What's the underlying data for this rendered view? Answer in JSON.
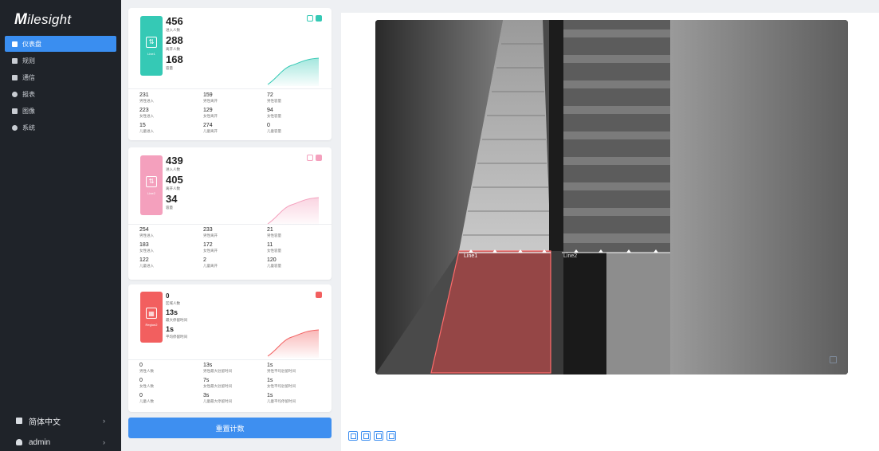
{
  "brand": {
    "logo_initial": "M",
    "logo_rest": "ilesight"
  },
  "sidebar": {
    "items": [
      {
        "label": "仪表盘",
        "icon": "dashboard-icon",
        "active": true
      },
      {
        "label": "规则",
        "icon": "rules-icon",
        "active": false
      },
      {
        "label": "通信",
        "icon": "communication-icon",
        "active": false
      },
      {
        "label": "报表",
        "icon": "report-icon",
        "active": false
      },
      {
        "label": "图像",
        "icon": "image-icon",
        "active": false
      },
      {
        "label": "系统",
        "icon": "gear-icon",
        "active": false
      }
    ],
    "language": {
      "label": "简体中文",
      "icon": "language-icon"
    },
    "user": {
      "label": "admin",
      "icon": "user-icon"
    },
    "chevron": "›"
  },
  "cards": [
    {
      "badge_label": "Line1",
      "accent": "#35c9b5",
      "main": [
        {
          "value": "456",
          "label": "进入人数"
        },
        {
          "value": "288",
          "label": "离开人数"
        },
        {
          "value": "168",
          "label": "容量"
        }
      ],
      "grid": [
        {
          "value": "231",
          "label": "男性进入"
        },
        {
          "value": "159",
          "label": "男性离开"
        },
        {
          "value": "72",
          "label": "男性容量"
        },
        {
          "value": "223",
          "label": "女性进入"
        },
        {
          "value": "129",
          "label": "女性离开"
        },
        {
          "value": "94",
          "label": "女性容量"
        },
        {
          "value": "15",
          "label": "儿童进入"
        },
        {
          "value": "274",
          "label": "儿童离开"
        },
        {
          "value": "0",
          "label": "儿童容量"
        }
      ]
    },
    {
      "badge_label": "Line2",
      "accent": "#f4a0bd",
      "main": [
        {
          "value": "439",
          "label": "进入人数"
        },
        {
          "value": "405",
          "label": "离开人数"
        },
        {
          "value": "34",
          "label": "容量"
        }
      ],
      "grid": [
        {
          "value": "254",
          "label": "男性进入"
        },
        {
          "value": "233",
          "label": "男性离开"
        },
        {
          "value": "21",
          "label": "男性容量"
        },
        {
          "value": "183",
          "label": "女性进入"
        },
        {
          "value": "172",
          "label": "女性离开"
        },
        {
          "value": "11",
          "label": "女性容量"
        },
        {
          "value": "122",
          "label": "儿童进入"
        },
        {
          "value": "2",
          "label": "儿童离开"
        },
        {
          "value": "120",
          "label": "儿童容量"
        }
      ]
    },
    {
      "badge_label": "Region2",
      "accent": "#f25f5f",
      "main": [
        {
          "value": "0",
          "label": "区域人数"
        },
        {
          "value": "13s",
          "label": "最大停留时间"
        },
        {
          "value": "1s",
          "label": "平均停留时间"
        }
      ],
      "grid": [
        {
          "value": "0",
          "label": "男性人数"
        },
        {
          "value": "13s",
          "label": "男性最大驻留时间"
        },
        {
          "value": "1s",
          "label": "男性平均驻留时间"
        },
        {
          "value": "0",
          "label": "女性人数"
        },
        {
          "value": "7s",
          "label": "女性最大驻留时间"
        },
        {
          "value": "1s",
          "label": "女性平均驻留时间"
        },
        {
          "value": "0",
          "label": "儿童人数"
        },
        {
          "value": "3s",
          "label": "儿童最大停留时间"
        },
        {
          "value": "1s",
          "label": "儿童平均停留时间"
        }
      ]
    }
  ],
  "reset_button": "重置计数",
  "video": {
    "line1_label": "Line1",
    "line2_label": "Line2",
    "region_color": "#e05050",
    "line_color": "#ffffff"
  },
  "toolbar": [
    {
      "icon": "region-draw-icon"
    },
    {
      "icon": "line-draw-icon"
    },
    {
      "icon": "snapshot-icon"
    },
    {
      "icon": "refresh-icon"
    }
  ]
}
